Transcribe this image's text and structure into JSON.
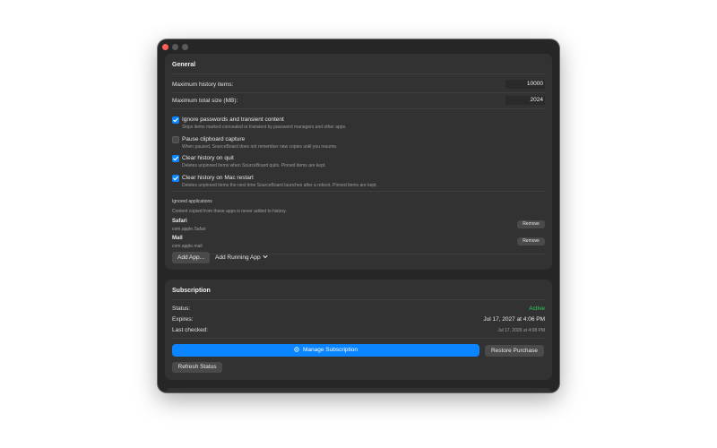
{
  "window": {
    "controls": [
      "close",
      "minimize",
      "zoom"
    ]
  },
  "general": {
    "heading": "General",
    "max_history_label": "Maximum history items:",
    "max_history_value": "10000",
    "max_size_label": "Maximum total size (MB):",
    "max_size_value": "2024",
    "options": [
      {
        "title": "Ignore passwords and transient content",
        "desc": "Skips items marked concealed or transient by password managers and other apps.",
        "checked": true
      },
      {
        "title": "Pause clipboard capture",
        "desc": "When paused, SourceBoard does not remember new copies until you resume.",
        "checked": false
      },
      {
        "title": "Clear history on quit",
        "desc": "Deletes unpinned items when SourceBoard quits. Pinned items are kept.",
        "checked": true
      },
      {
        "title": "Clear history on Mac restart",
        "desc": "Deletes unpinned items the next time SourceBoard launches after a reboot. Pinned items are kept.",
        "checked": true
      }
    ],
    "ignored_heading": "Ignored applications",
    "ignored_desc": "Content copied from these apps is never added to history.",
    "apps": [
      {
        "name": "Safari",
        "bundle": "com.apple.Safari",
        "remove_label": "Remove"
      },
      {
        "name": "Mail",
        "bundle": "com.apple.mail",
        "remove_label": "Remove"
      }
    ],
    "add_app_label": "Add App...",
    "add_running_label": "Add Running App"
  },
  "subscription": {
    "heading": "Subscription",
    "status_label": "Status:",
    "status_value": "Active",
    "expires_label": "Expires:",
    "expires_value": "Jul 17, 2027 at 4:06 PM",
    "last_checked_label": "Last checked:",
    "last_checked_value": "Jul 17, 2026 at 4:08 PM",
    "manage_label": "Manage Subscription",
    "restore_label": "Restore Purchase",
    "refresh_label": "Refresh Status"
  },
  "colors": {
    "accent": "#0a84ff",
    "active": "#30d158",
    "close": "#ff5f57"
  }
}
